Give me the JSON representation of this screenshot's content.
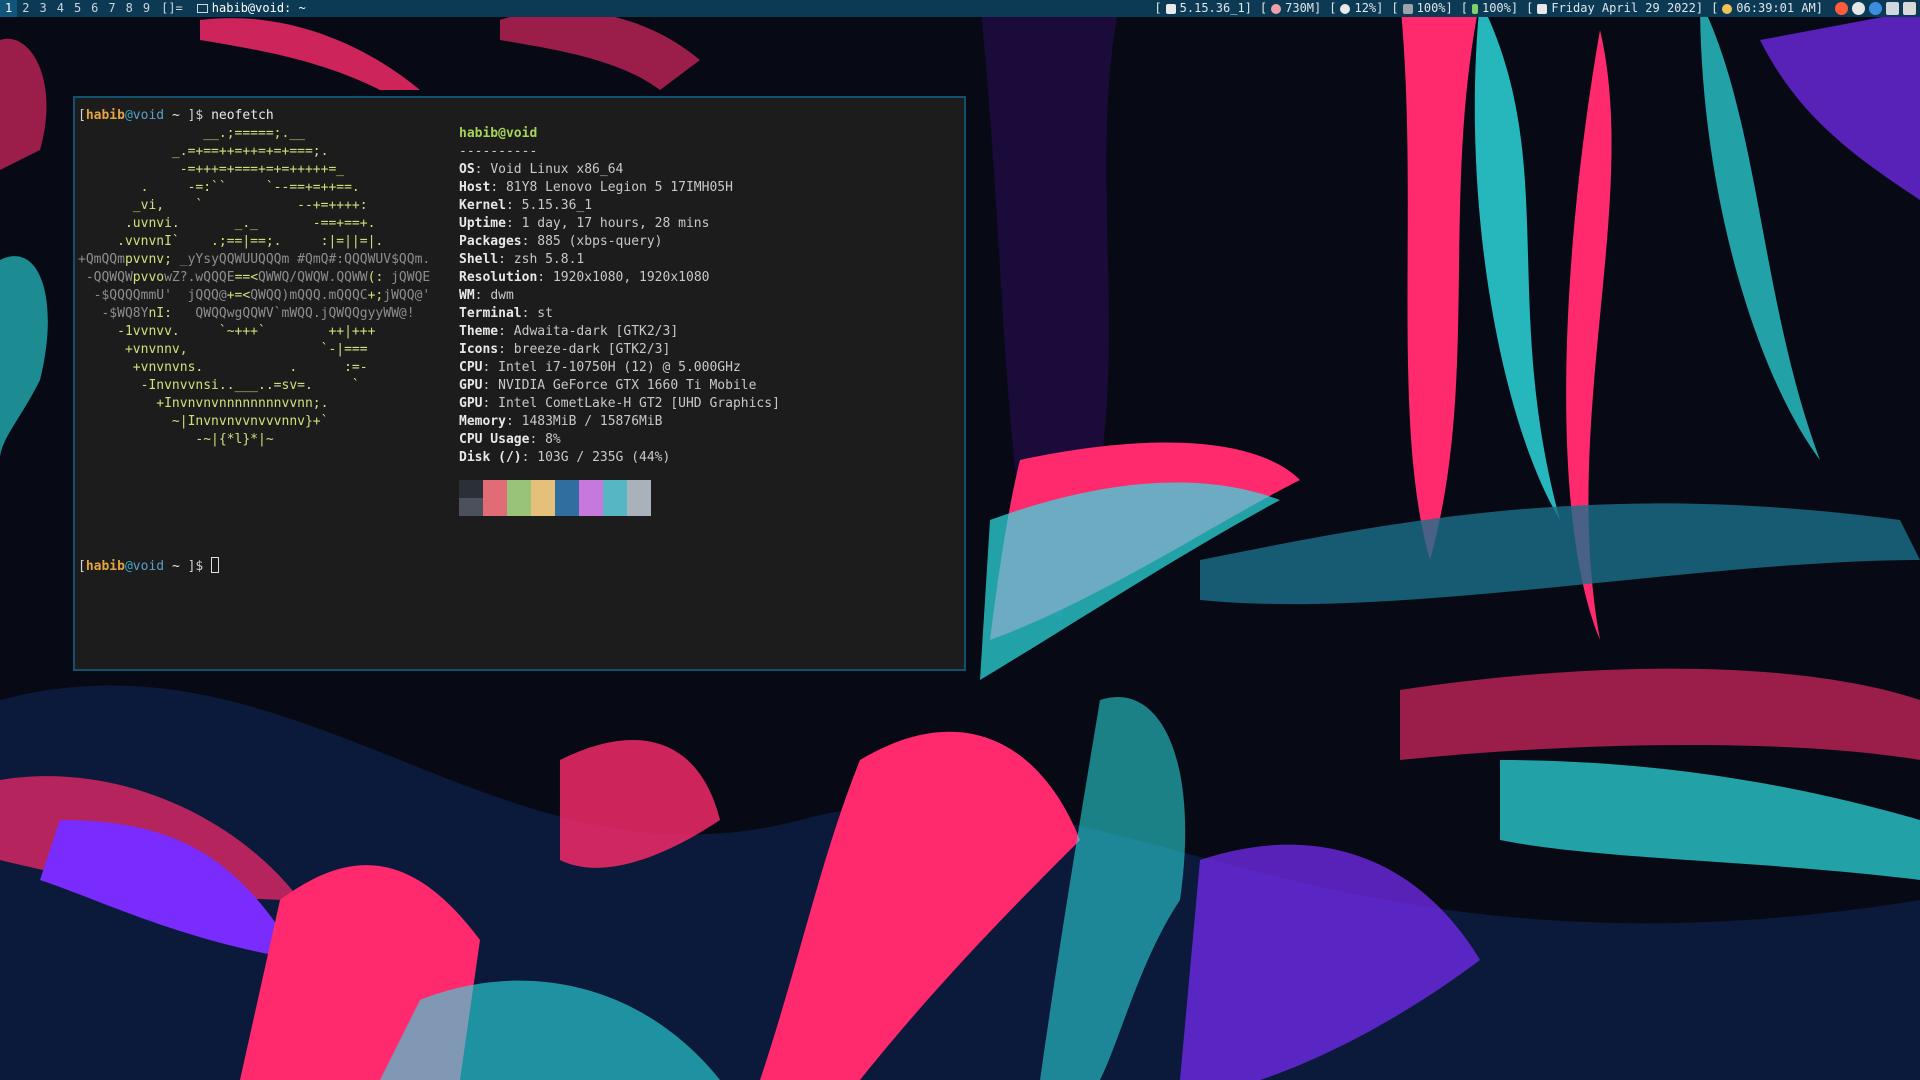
{
  "bar": {
    "workspaces": [
      "1",
      "2",
      "3",
      "4",
      "5",
      "6",
      "7",
      "8",
      "9"
    ],
    "active_workspace": "1",
    "layout_symbol": "[]=",
    "window_title": "habib@void: ~",
    "kernel": "5.15.36_1]",
    "memory": "730M]",
    "cpu": "12%]",
    "volume": "100%]",
    "battery": "100%]",
    "date": "Friday April 29 2022]",
    "time": "06:39:01 AM]"
  },
  "terminal": {
    "prompt": {
      "user": "habib",
      "at": "@",
      "host": "void",
      "dir": "~"
    },
    "command": "neofetch",
    "info": {
      "user_host": "habib@void",
      "separator": "----------",
      "rows": [
        {
          "k": "OS",
          "v": "Void Linux x86_64"
        },
        {
          "k": "Host",
          "v": "81Y8 Lenovo Legion 5 17IMH05H"
        },
        {
          "k": "Kernel",
          "v": "5.15.36_1"
        },
        {
          "k": "Uptime",
          "v": "1 day, 17 hours, 28 mins"
        },
        {
          "k": "Packages",
          "v": "885 (xbps-query)"
        },
        {
          "k": "Shell",
          "v": "zsh 5.8.1"
        },
        {
          "k": "Resolution",
          "v": "1920x1080, 1920x1080"
        },
        {
          "k": "WM",
          "v": "dwm"
        },
        {
          "k": "Terminal",
          "v": "st"
        },
        {
          "k": "Theme",
          "v": "Adwaita-dark [GTK2/3]"
        },
        {
          "k": "Icons",
          "v": "breeze-dark [GTK2/3]"
        },
        {
          "k": "CPU",
          "v": "Intel i7-10750H (12) @ 5.000GHz"
        },
        {
          "k": "GPU",
          "v": "NVIDIA GeForce GTX 1660 Ti Mobile"
        },
        {
          "k": "GPU",
          "v": "Intel CometLake-H GT2 [UHD Graphics]"
        },
        {
          "k": "Memory",
          "v": "1483MiB / 15876MiB"
        },
        {
          "k": "CPU Usage",
          "v": "8%"
        },
        {
          "k": "Disk (/)",
          "v": "103G / 235G (44%)"
        }
      ]
    },
    "palette_top": [
      "#2b2f36",
      "#e06c75",
      "#98c379",
      "#e5c07b",
      "#2f6e9e",
      "#c678dd",
      "#56b6c2",
      "#a9b2bb"
    ],
    "palette_bottom": [
      "#4b515c",
      "#e06c75",
      "#98c379",
      "#e5c07b",
      "#2f6e9e",
      "#c678dd",
      "#56b6c2",
      "#a9b2bb"
    ]
  }
}
